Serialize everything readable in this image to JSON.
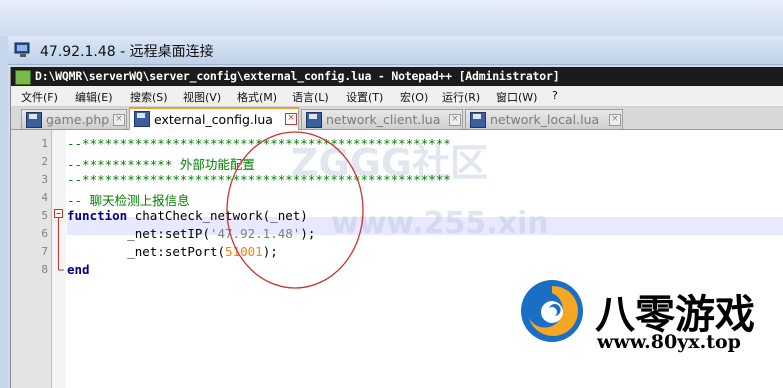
{
  "rdp": {
    "title": "47.92.1.48 - 远程桌面连接"
  },
  "npp": {
    "title": "D:\\WQMR\\serverWQ\\server_config\\external_config.lua - Notepad++ [Administrator]",
    "menu": [
      "文件(F)",
      "编辑(E)",
      "搜索(S)",
      "视图(V)",
      "格式(M)",
      "语言(L)",
      "设置(T)",
      "宏(O)",
      "运行(R)",
      "窗口(W)",
      "?"
    ],
    "tabs": [
      {
        "label": "game.php",
        "active": false
      },
      {
        "label": "external_config.lua",
        "active": true
      },
      {
        "label": "network_client.lua",
        "active": false
      },
      {
        "label": "network_local.lua",
        "active": false
      }
    ],
    "lines": [
      {
        "num": "1",
        "code": "--*************************************************"
      },
      {
        "num": "2",
        "code": "--************ 外部功能配置"
      },
      {
        "num": "3",
        "code": "--*************************************************"
      },
      {
        "num": "4",
        "code": "-- 聊天检测上报信息"
      },
      {
        "num": "5",
        "kw": "function",
        "rest": " chatCheck_network(_net)"
      },
      {
        "num": "6",
        "pre": "        _net:setIP(",
        "str": "'47.92.1.48'",
        "post": ");"
      },
      {
        "num": "7",
        "pre": "        _net:setPort(",
        "numval": "51001",
        "post": ");"
      },
      {
        "num": "8",
        "kw": "end"
      }
    ]
  },
  "watermark": {
    "cn": "ZGGG社区",
    "url": "www.255.xin"
  },
  "logo": {
    "cn": "八零游戏",
    "url": "www.80yx.top"
  },
  "colors": {
    "accent_tab": "#f59e2b",
    "comment": "#008000",
    "keyword": "#00008b",
    "number": "#ff8000"
  }
}
